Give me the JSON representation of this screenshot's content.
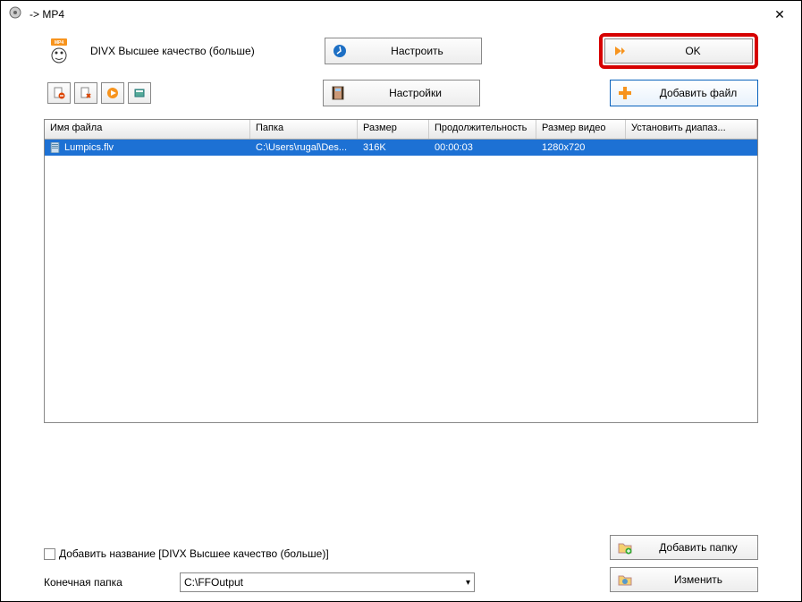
{
  "window": {
    "title": "-> MP4"
  },
  "toolbar": {
    "profile_label": "DIVX Высшее качество (больше)",
    "configure_label": "Настроить",
    "settings_label": "Настройки",
    "ok_label": "OK",
    "add_file_label": "Добавить файл"
  },
  "table": {
    "cols": [
      "Имя файла",
      "Папка",
      "Размер",
      "Продолжительность",
      "Размер видео",
      "Установить диапаз..."
    ],
    "row": {
      "name": "Lumpics.flv",
      "folder": "C:\\Users\\rugal\\Des...",
      "size": "316K",
      "duration": "00:00:03",
      "vsize": "1280x720",
      "range": ""
    }
  },
  "bottom": {
    "add_name_label": "Добавить название [DIVX Высшее качество (больше)]",
    "output_label": "Конечная папка",
    "output_value": "C:\\FFOutput",
    "add_folder_label": "Добавить папку",
    "change_label": "Изменить"
  }
}
